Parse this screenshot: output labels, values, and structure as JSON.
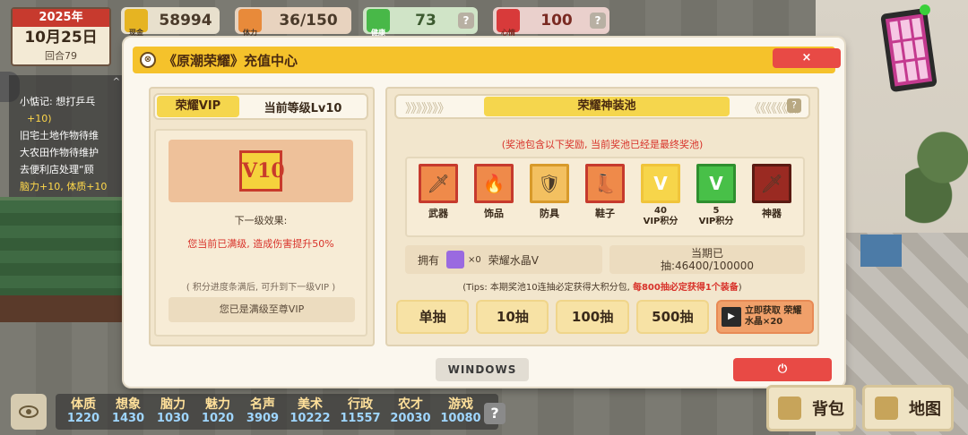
{
  "hud": {
    "date": {
      "year": "2025年",
      "day": "10月25日",
      "turn": "回合79"
    },
    "cash": {
      "label": "现金",
      "value": "58994",
      "icon": "coin-stack-icon"
    },
    "stamina": {
      "label": "体力",
      "value": "36/150",
      "icon": "lightning-icon"
    },
    "health": {
      "label": "健康",
      "value": "73",
      "icon": "green-cross-icon"
    },
    "mood": {
      "label": "心情",
      "value": "100",
      "icon": "heart-icon"
    },
    "help": "?"
  },
  "quests": {
    "collapse": "^",
    "items": [
      {
        "text": "小惦记: 想打乒乓",
        "sub": "+10)"
      },
      {
        "text": "旧宅土地作物待维"
      },
      {
        "text": "大农田作物待维护"
      },
      {
        "text": "去便利店处理“顾",
        "sub": "脑力+10, 体质+10"
      }
    ]
  },
  "bottom_stats": [
    {
      "name": "体质",
      "value": "1220"
    },
    {
      "name": "想象",
      "value": "1430"
    },
    {
      "name": "脑力",
      "value": "1030"
    },
    {
      "name": "魅力",
      "value": "1020"
    },
    {
      "name": "名声",
      "value": "3909"
    },
    {
      "name": "美术",
      "value": "10222"
    },
    {
      "name": "行政",
      "value": "11557"
    },
    {
      "name": "农才",
      "value": "20030"
    },
    {
      "name": "游戏",
      "value": "10080"
    }
  ],
  "bottom_help": "?",
  "nav": {
    "bag": "背包",
    "map": "地图"
  },
  "modal": {
    "title": "《原潮荣耀》充值中心",
    "close": "×",
    "left": {
      "tab_active": "荣耀VIP",
      "tab_level": "当前等级Lv10",
      "vip_badge": "V10",
      "next_label": "下一级效果:",
      "effect": "您当前已满级, 造成伤害提升50%",
      "hint": "( 积分进度条满后, 可升到下一级VIP )",
      "maxed": "您已是满级至尊VIP"
    },
    "right": {
      "chev_left": "》》》》》》》",
      "chev_right": "《《《《《《《《",
      "tab_active": "荣耀神装池",
      "help": "?",
      "note": "(奖池包含以下奖励, 当前奖池已经是最终奖池)",
      "prizes": [
        {
          "label": "武器",
          "icon": "sword-icon",
          "glyph": "🗡"
        },
        {
          "label": "饰品",
          "icon": "twin-flames-icon",
          "glyph": "🔥"
        },
        {
          "label": "防具",
          "icon": "armor-icon",
          "glyph": "🛡"
        },
        {
          "label": "鞋子",
          "icon": "boots-icon",
          "glyph": "👢"
        },
        {
          "label": "VIP积分",
          "amount": "40",
          "icon": "gold-v-icon",
          "glyph": "V"
        },
        {
          "label": "VIP积分",
          "amount": "5",
          "icon": "green-v-icon",
          "glyph": "V"
        },
        {
          "label": "神器",
          "icon": "divine-sword-icon",
          "glyph": "🗡"
        }
      ],
      "own_label": "拥有",
      "own_count": "×0",
      "own_item": "荣耀水晶Ⅴ",
      "period_label": "当期已",
      "period_value": "抽:46400/100000",
      "tips_prefix": "(Tips: 本期奖池10连抽必定获得大积分包, ",
      "tips_red": "每800抽必定获得1个装备",
      "tips_suffix": ")",
      "draws": [
        "单抽",
        "10抽",
        "100抽",
        "500抽"
      ],
      "get_crystal": "立即获取 荣耀水晶×20"
    },
    "windows_btn": "WINDOWS",
    "power": "⏻"
  }
}
